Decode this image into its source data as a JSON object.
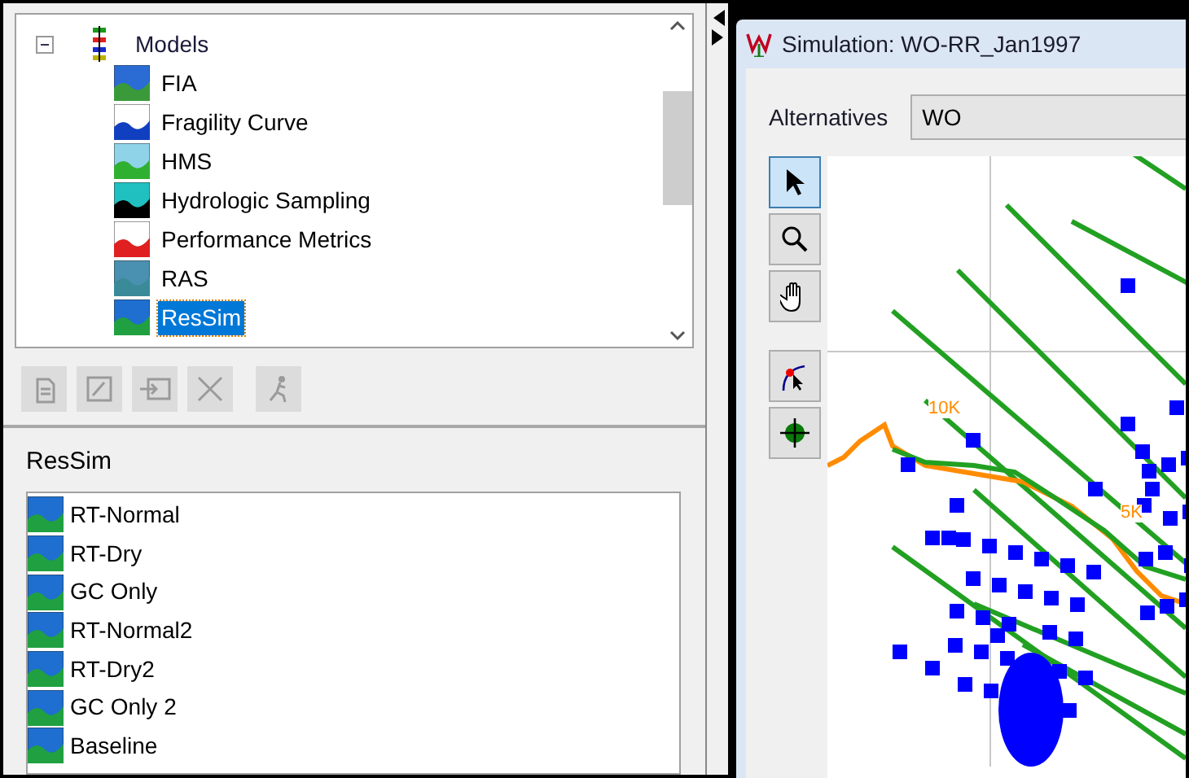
{
  "tree": {
    "label": "Models",
    "expanded": true,
    "children": [
      {
        "label": "FIA",
        "kind": "fia",
        "selected": false
      },
      {
        "label": "Fragility Curve",
        "kind": "fragility",
        "selected": false
      },
      {
        "label": "HMS",
        "kind": "hms",
        "selected": false
      },
      {
        "label": "Hydrologic Sampling",
        "kind": "hs",
        "selected": false
      },
      {
        "label": "Performance Metrics",
        "kind": "metrics",
        "selected": false
      },
      {
        "label": "RAS",
        "kind": "ras",
        "selected": false
      },
      {
        "label": "ResSim",
        "kind": "ressim",
        "selected": true
      }
    ]
  },
  "toolbar": [
    {
      "kind": "new",
      "disabled": true
    },
    {
      "kind": "edit",
      "disabled": true
    },
    {
      "kind": "import",
      "disabled": true
    },
    {
      "kind": "delete",
      "disabled": true
    },
    {
      "kind": "run",
      "disabled": true
    }
  ],
  "list": {
    "title": "ResSim",
    "items": [
      "RT-Normal",
      "RT-Dry",
      "GC Only",
      "RT-Normal2",
      "RT-Dry2",
      "GC Only 2",
      "Baseline"
    ]
  },
  "simulation": {
    "title": "Simulation: WO-RR_Jan1997",
    "alternatives_label": "Alternatives",
    "alternative": "WO",
    "tools": [
      {
        "kind": "select",
        "selected": true
      },
      {
        "kind": "zoom",
        "selected": false
      },
      {
        "kind": "pan",
        "selected": false
      },
      {
        "kind": "edit-point",
        "selected": false
      },
      {
        "kind": "target",
        "selected": false
      }
    ],
    "map_labels": [
      "10K",
      "5K"
    ]
  }
}
